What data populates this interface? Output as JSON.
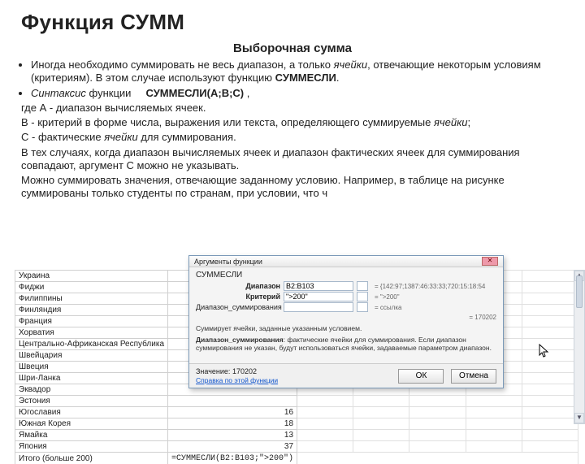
{
  "title": "Функция СУММ",
  "subtitle": "Выборочная сумма",
  "bullet1_a": "Иногда необходимо суммировать не весь диапазон, а только ",
  "bullet1_em": "ячейки",
  "bullet1_b": ", отвечающие некоторым условиям (критериям). В этом случае используют функцию ",
  "bullet1_bold": "СУММЕСЛИ",
  "bullet1_c": ".",
  "bullet2_a_em": "Синтаксис",
  "bullet2_a": " функции     ",
  "bullet2_bold": "СУММЕСЛИ(А;В;С)",
  "bullet2_b": " ,",
  "lineA": "где А - диапазон вычисляемых ячеек.",
  "lineB_a": "В - критерий в форме числа, выражения или текста, определяющего суммируемые ",
  "lineB_em": "ячейки",
  "lineB_b": ";",
  "lineC_a": "С - фактические ",
  "lineC_em": "ячейки",
  "lineC_b": " для суммирования.",
  "para1": "В тех случаях, когда диапазон вычисляемых ячеек и диапазон фактических ячеек для суммирования совпадают, аргумент С можно не указывать.",
  "para2": "Можно суммировать значения, отвечающие заданному условию. Например, в таблице на рисунке суммированы только студенты по странам, при условии, что ч",
  "sheet": {
    "rows": [
      {
        "country": "Украина",
        "val": ""
      },
      {
        "country": "Фиджи",
        "val": ""
      },
      {
        "country": "Филиппины",
        "val": ""
      },
      {
        "country": "Финляндия",
        "val": ""
      },
      {
        "country": "Франция",
        "val": ""
      },
      {
        "country": "Хорватия",
        "val": ""
      },
      {
        "country": "Центрально-Африканская Республика",
        "val": ""
      },
      {
        "country": "Швейцария",
        "val": ""
      },
      {
        "country": "Швеция",
        "val": ""
      },
      {
        "country": "Шри-Ланка",
        "val": ""
      },
      {
        "country": "Эквадор",
        "val": ""
      },
      {
        "country": "Эстония",
        "val": ""
      },
      {
        "country": "Югославия",
        "val": "16"
      },
      {
        "country": "Южная Корея",
        "val": "18"
      },
      {
        "country": "Ямайка",
        "val": "13"
      },
      {
        "country": "Япония",
        "val": "37"
      }
    ],
    "total_label": "Итого (больше 200)",
    "formula": "=СУММЕСЛИ(B2:B103;\">200\")"
  },
  "dialog": {
    "title": "Аргументы функции",
    "func": "СУММЕСЛИ",
    "args": [
      {
        "label": "Диапазон",
        "val": "B2:B103",
        "eval": "= {142:97;1387:46:33:33;720:15:18:54"
      },
      {
        "label": "Критерий",
        "val": "\">200\"",
        "eval": "= \">200\""
      },
      {
        "label": "Диапазон_суммирования",
        "val": "",
        "eval": "= ссылка"
      }
    ],
    "preview": "= 170202",
    "hint_lead": "Суммирует ячейки, заданные указанным условием.",
    "hint_bold": "Диапазон_суммирования",
    "hint_rest": ": фактические ячейки для суммирования. Если диапазон суммирования не указан, будут использоваться ячейки, задаваемые параметром диапазон.",
    "result_label": "Значение:",
    "result": "170202",
    "help": "Справка по этой функции",
    "ok": "ОК",
    "cancel": "Отмена"
  }
}
